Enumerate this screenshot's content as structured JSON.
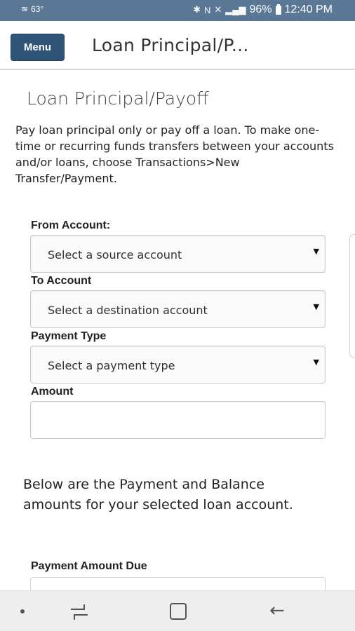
{
  "status_bar": {
    "left_text": "63°",
    "battery": "96%",
    "time": "12:40 PM"
  },
  "header": {
    "menu_label": "Menu",
    "title": "Loan Principal/P..."
  },
  "page": {
    "title": "Loan Principal/Payoff",
    "intro": "Pay loan principal only or pay off a loan. To make one-time or recurring funds transfers between your accounts and/or loans, choose Transactions>New Transfer/Payment."
  },
  "form": {
    "from_account": {
      "label": "From Account:",
      "selected": "Select a source account"
    },
    "to_account": {
      "label": "To Account",
      "selected": "Select a destination account"
    },
    "payment_type": {
      "label": "Payment Type",
      "selected": "Select a payment type"
    },
    "amount": {
      "label": "Amount",
      "value": ""
    }
  },
  "balance_info": {
    "text": "Below are the Payment and Balance amounts for your selected loan account.",
    "payment_amount_due_label": "Payment Amount Due"
  },
  "icons": {
    "caret": "▼",
    "back": "←"
  }
}
